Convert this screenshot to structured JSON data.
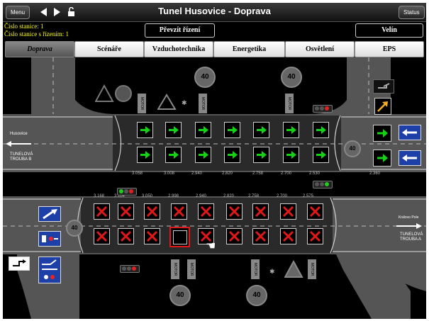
{
  "topbar": {
    "menu_label": "Menu",
    "title": "Tunel Husovice - Doprava",
    "status_label": "Status"
  },
  "info": {
    "station": "Číslo stanice: 1",
    "control_station": "Číslo stanice s řízením: 1"
  },
  "controls": {
    "takeover_label": "Převzít řízení",
    "velin_label": "Velín"
  },
  "tabs": [
    "Doprava",
    "Scénáře",
    "Vzduchotechnika",
    "Energetika",
    "Osvětlení",
    "EPS"
  ],
  "tunnel_b": {
    "left_label": "Husovice",
    "name_line1": "TUNELOVÁ",
    "name_line2": "TROUBA B",
    "distances": [
      "3.058",
      "3.008",
      "2.940",
      "2.820",
      "2.758",
      "2.700",
      "2.530",
      "2.360"
    ]
  },
  "tunnel_a": {
    "right_label": "Královo Pole",
    "name_line1": "TUNELOVÁ",
    "name_line2": "TROUBA A",
    "distances": [
      "3.168",
      "3.114",
      "3.050",
      "2.998",
      "2.940",
      "2.820",
      "2.758",
      "2.700",
      "2.575"
    ]
  },
  "speed_limit": "40",
  "sign_text": "MOTOR STOP",
  "colors": {
    "green_arrow": "#14d214",
    "red_cross": "#e01818",
    "blue_button": "#1d3fa8",
    "yellow_text": "#ffff00"
  },
  "icons": [
    "green-arrow-icon",
    "red-cross-icon",
    "speed-limit-icon",
    "motor-stop-sign-icon",
    "traffic-light-icon",
    "hand-cursor-icon"
  ]
}
